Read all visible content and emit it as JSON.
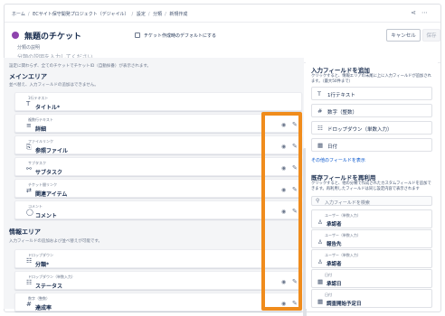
{
  "breadcrumb": [
    "ホーム",
    "ECサイト保守開発プロジェクト（デジャイル）",
    "設定",
    "分類",
    "新規作成"
  ],
  "header": {
    "title": "無題のチケット",
    "title_dot_color": "#8e44ad",
    "default_checkbox_label": "チケット作成時のデフォルトにする",
    "cancel_label": "キャンセル",
    "save_label": "保存",
    "desc_label": "分類の説明",
    "desc_placeholder": "分類の説明を入力してください"
  },
  "main": {
    "note": "設定に関わらず、全てのチケットでチケットID（自動採番）が表示されます。",
    "section1_title": "メインエリア",
    "section1_sub": "並べ替え、入力フィールドの追加はできません。",
    "fields1": [
      {
        "type": "1行テキスト",
        "name": "タイトル*",
        "icon": "T",
        "editable": false
      },
      {
        "type": "複数行テキスト",
        "name": "詳細",
        "icon": "≡",
        "editable": true
      },
      {
        "type": "ファイルリンク",
        "name": "参照ファイル",
        "icon": "⎘",
        "editable": true
      },
      {
        "type": "サブタスク",
        "name": "サブタスク",
        "icon": "⚯",
        "editable": true
      },
      {
        "type": "チケット間リンク",
        "name": "関連アイテム",
        "icon": "⇄",
        "editable": true
      },
      {
        "type": "コメント",
        "name": "コメント",
        "icon": "◯",
        "editable": true
      }
    ],
    "section2_title": "情報エリア",
    "section2_sub": "入力フィールドの追加および並べ替えが可能です。",
    "fields2": [
      {
        "type": "ドロップダウン",
        "name": "分類*",
        "icon": "☷",
        "editable": false
      },
      {
        "type": "ドロップダウン（単数入力）",
        "name": "ステータス",
        "icon": "☷",
        "editable": true
      },
      {
        "type": "数字（整数）",
        "name": "達成率",
        "icon": "#",
        "editable": true
      }
    ]
  },
  "right": {
    "add_title": "入力フィールドを追加",
    "add_sub": "クリックすると、情報エリアの末尾に上に入力フィールドが追加されます。（最大50件まで）",
    "add_items": [
      {
        "icon": "T",
        "label": "1行テキスト"
      },
      {
        "icon": "#",
        "label": "数字（整数）"
      },
      {
        "icon": "☷",
        "label": "ドロップダウン（単数入力）"
      },
      {
        "icon": "▦",
        "label": "日付"
      }
    ],
    "more_link": "その他のフィールドを表示",
    "reuse_title": "既存フィールドを再利用",
    "reuse_sub": "クリックすると、他の分類で作成されたカスタムフィールドを追加できます。再利用したフィールドは同じ設定内容で表示されます",
    "search_placeholder": "入力フィールドを検索",
    "reuse_items": [
      {
        "type": "ユーザー（単数入力）",
        "name": "承認者",
        "icon": "♙"
      },
      {
        "type": "ユーザー（単数入力）",
        "name": "報告先",
        "icon": "♙"
      },
      {
        "type": "ユーザー（単数入力）",
        "name": "承認者",
        "icon": "♙"
      },
      {
        "type": "日付",
        "name": "承認日",
        "icon": "▦"
      },
      {
        "type": "日付",
        "name": "調査開始予定日",
        "icon": "▦"
      }
    ]
  },
  "icons": {
    "eye": "◉",
    "pencil": "✎",
    "share": "⋖",
    "more": "⋯",
    "search": "⚲"
  },
  "highlight_color": "#f08c1c"
}
